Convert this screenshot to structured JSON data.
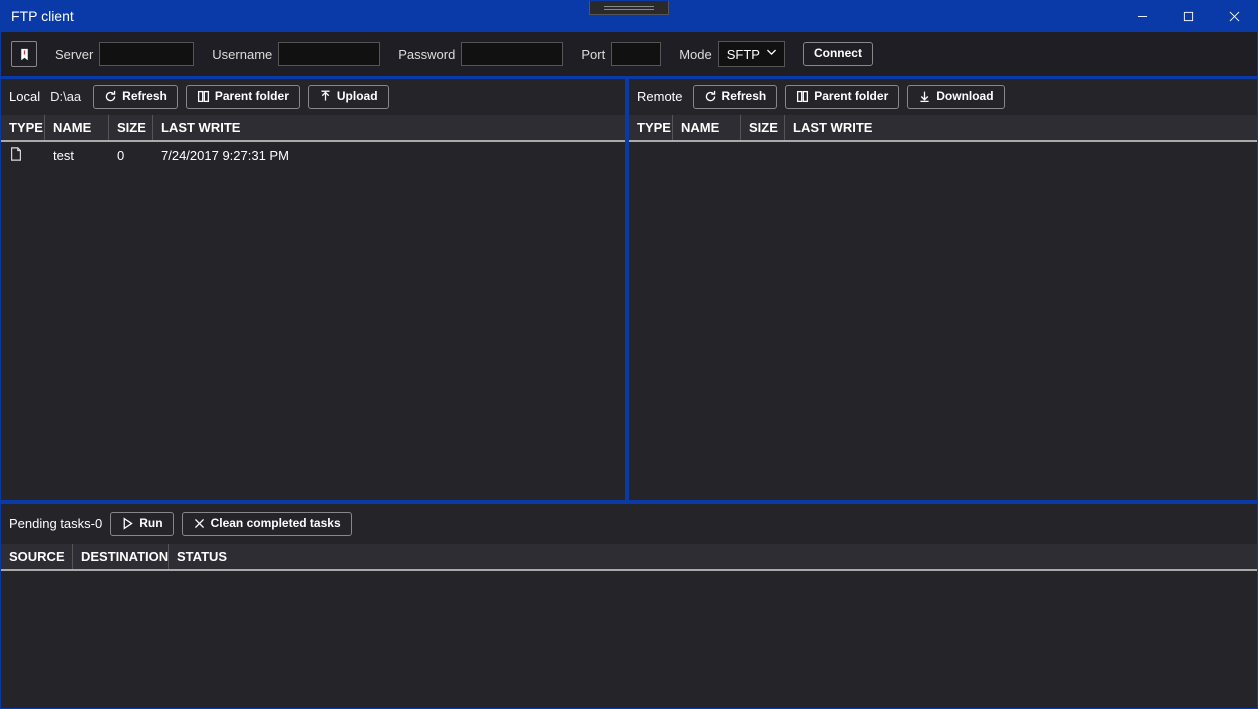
{
  "window": {
    "title": "FTP client"
  },
  "toolbar": {
    "server_label": "Server",
    "server_value": "",
    "username_label": "Username",
    "username_value": "",
    "password_label": "Password",
    "password_value": "",
    "port_label": "Port",
    "port_value": "",
    "mode_label": "Mode",
    "mode_value": "SFTP",
    "connect_label": "Connect"
  },
  "local": {
    "title": "Local",
    "path": "D:\\aa",
    "refresh_label": "Refresh",
    "parent_label": "Parent folder",
    "upload_label": "Upload",
    "columns": {
      "type": "TYPE",
      "name": "NAME",
      "size": "SIZE",
      "last_write": "LAST WRITE"
    },
    "rows": [
      {
        "type_icon": "file-icon",
        "name": "test",
        "size": "0",
        "last_write": "7/24/2017 9:27:31 PM"
      }
    ]
  },
  "remote": {
    "title": "Remote",
    "refresh_label": "Refresh",
    "parent_label": "Parent folder",
    "download_label": "Download",
    "columns": {
      "type": "TYPE",
      "name": "NAME",
      "size": "SIZE",
      "last_write": "LAST WRITE"
    },
    "rows": []
  },
  "tasks": {
    "title": "Pending tasks-0",
    "run_label": "Run",
    "clean_label": "Clean completed tasks",
    "columns": {
      "source": "SOURCE",
      "destination": "DESTINATION",
      "status": "STATUS"
    },
    "rows": []
  }
}
